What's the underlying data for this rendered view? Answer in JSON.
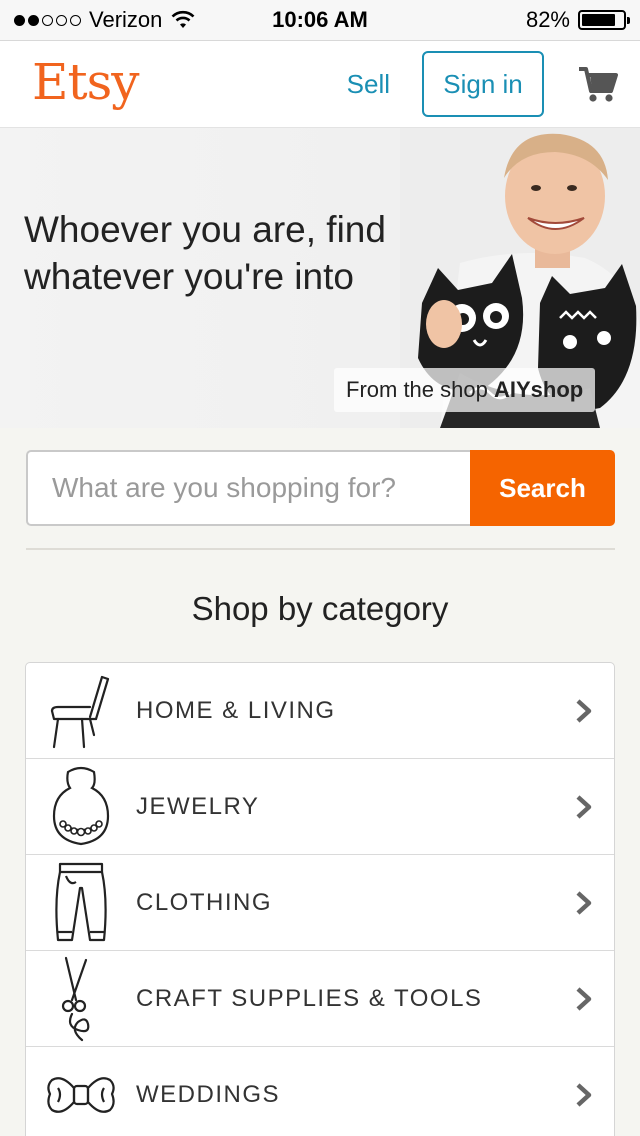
{
  "status_bar": {
    "carrier": "Verizon",
    "time": "10:06 AM",
    "battery": "82%",
    "battery_level": 0.82,
    "signal_bars": 2,
    "signal_total": 5,
    "icons": [
      "signal-dots-icon",
      "wifi-icon",
      "battery-icon"
    ]
  },
  "header": {
    "logo": "Etsy",
    "sell_label": "Sell",
    "signin_label": "Sign in",
    "cart_icon": "shopping-cart-icon"
  },
  "hero": {
    "title": "Whoever you are, find whatever you're into",
    "credit_prefix": "From the shop",
    "credit_shop": "AIYshop"
  },
  "search": {
    "placeholder": "What are you shopping for?",
    "value": "",
    "button_label": "Search"
  },
  "section_title": "Shop by category",
  "categories": [
    {
      "label": "HOME & LIVING",
      "icon": "chair-icon"
    },
    {
      "label": "JEWELRY",
      "icon": "necklace-icon"
    },
    {
      "label": "CLOTHING",
      "icon": "pants-icon"
    },
    {
      "label": "CRAFT SUPPLIES & TOOLS",
      "icon": "scissors-icon"
    },
    {
      "label": "WEDDINGS",
      "icon": "bow-tie-icon"
    }
  ],
  "colors": {
    "brand_orange": "#f1641e",
    "search_orange": "#f56400",
    "link_blue": "#1a8fb4",
    "background": "#f5f5f1"
  }
}
